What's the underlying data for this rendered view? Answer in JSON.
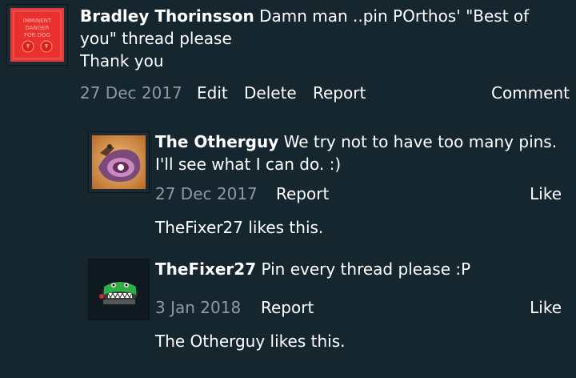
{
  "post": {
    "username": "Bradley Thorinsson",
    "message": "Damn man ..pin POrthos' \"Best of you\" thread please",
    "message_line2": "Thank you",
    "date": "27 Dec 2017",
    "actions": {
      "edit": "Edit",
      "delete": "Delete",
      "report": "Report",
      "comment": "Comment"
    },
    "avatar": {
      "icon": "warning-sign-avatar",
      "text_lines": [
        "IMMINENT",
        "DANGER",
        "FOR DOG"
      ]
    }
  },
  "replies": [
    {
      "username": "The Otherguy",
      "message": "We try not to have too many pins. I'll see what I can do. :)",
      "date": "27 Dec 2017",
      "report": "Report",
      "like": "Like",
      "likes_text": "TheFixer27 likes this.",
      "avatar": {
        "icon": "eye-creature-avatar"
      }
    },
    {
      "username": "TheFixer27",
      "message": "Pin every thread please :P",
      "date": "3 Jan 2018",
      "report": "Report",
      "like": "Like",
      "likes_text": "The Otherguy likes this.",
      "avatar": {
        "icon": "green-monster-avatar"
      }
    }
  ],
  "colors": {
    "background": "#15262f",
    "date_gray": "#8c9aa3",
    "text": "#ffffff"
  }
}
